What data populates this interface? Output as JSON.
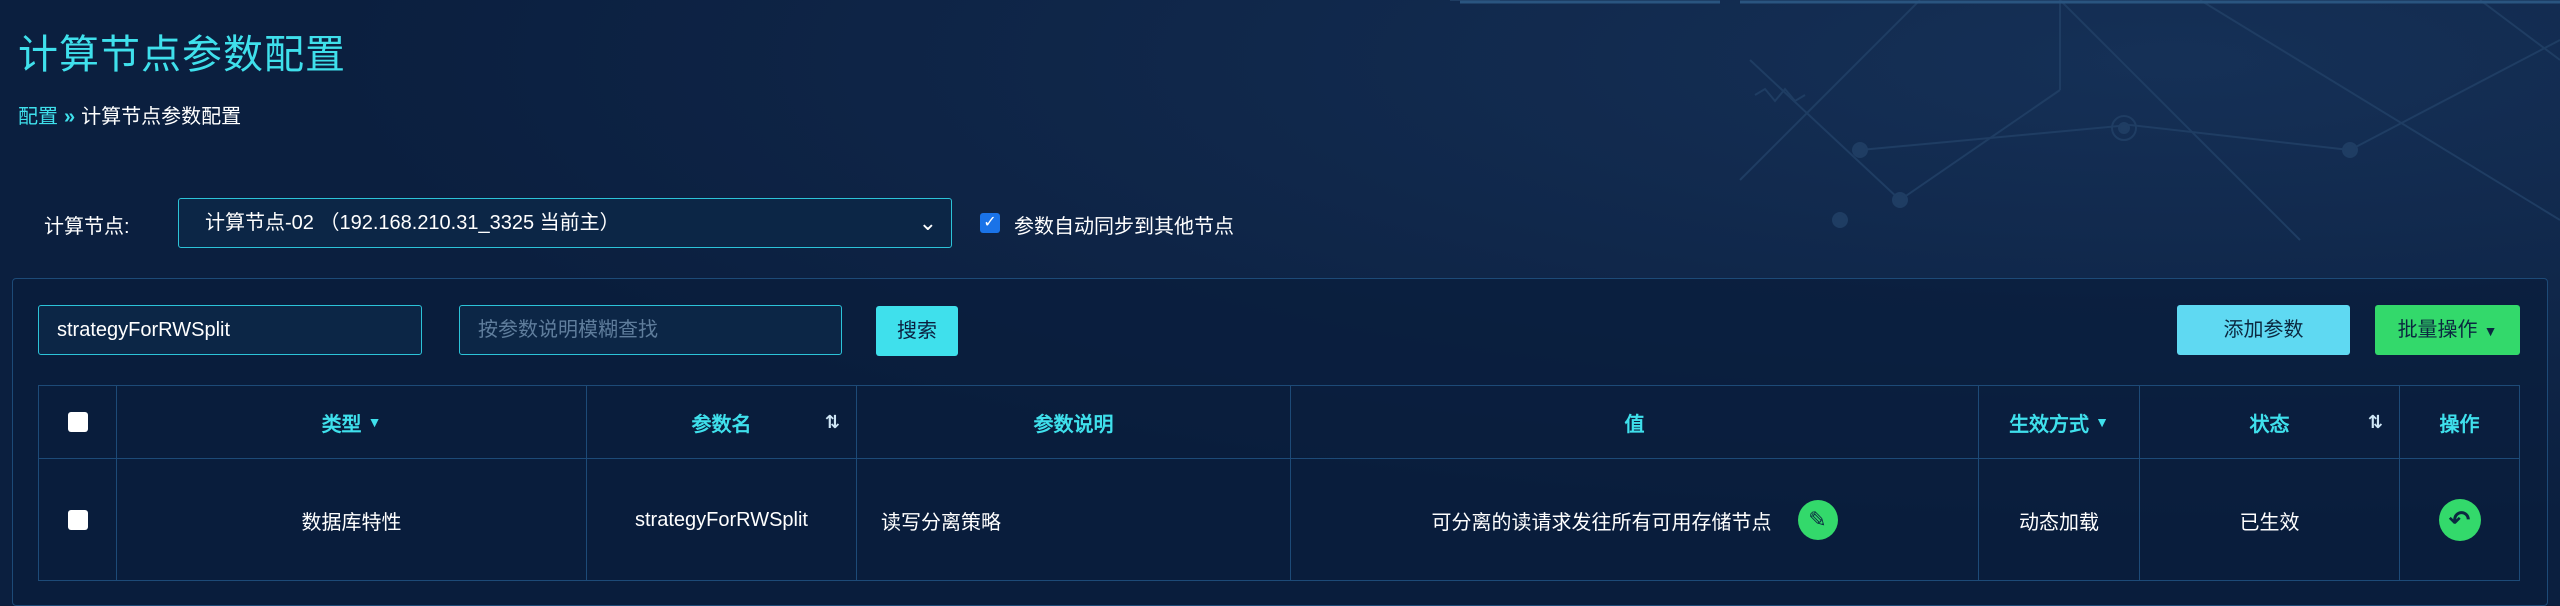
{
  "page": {
    "title": "计算节点参数配置"
  },
  "breadcrumb": {
    "link": "配置",
    "separator": "»",
    "current": "计算节点参数配置"
  },
  "node_selector": {
    "label": "计算节点:",
    "value": "计算节点-02 （192.168.210.31_3325 当前主）",
    "chevron": "⌄"
  },
  "sync_option": {
    "checked": true,
    "label": "参数自动同步到其他节点"
  },
  "toolbar": {
    "param_search_value": "strategyForRWSplit",
    "desc_search_placeholder": "按参数说明模糊查找",
    "search_label": "搜索",
    "add_label": "添加参数",
    "batch_label": "批量操作"
  },
  "table": {
    "headers": {
      "type": "类型",
      "name": "参数名",
      "desc": "参数说明",
      "value": "值",
      "mode": "生效方式",
      "status": "状态",
      "action": "操作"
    },
    "rows": [
      {
        "type": "数据库特性",
        "name": "strategyForRWSplit",
        "desc": "读写分离策略",
        "value": "可分离的读请求发往所有可用存储节点",
        "mode": "动态加载",
        "status": "已生效"
      }
    ]
  },
  "colors": {
    "accent": "#3fe0ec",
    "background": "#0b1f3f",
    "green": "#33d96b",
    "add_button": "#5fd9f2"
  },
  "icons": {
    "edit": "pencil-icon",
    "action": "undo-icon",
    "sort": "sort-icon",
    "dropdown": "caret-down-icon"
  }
}
